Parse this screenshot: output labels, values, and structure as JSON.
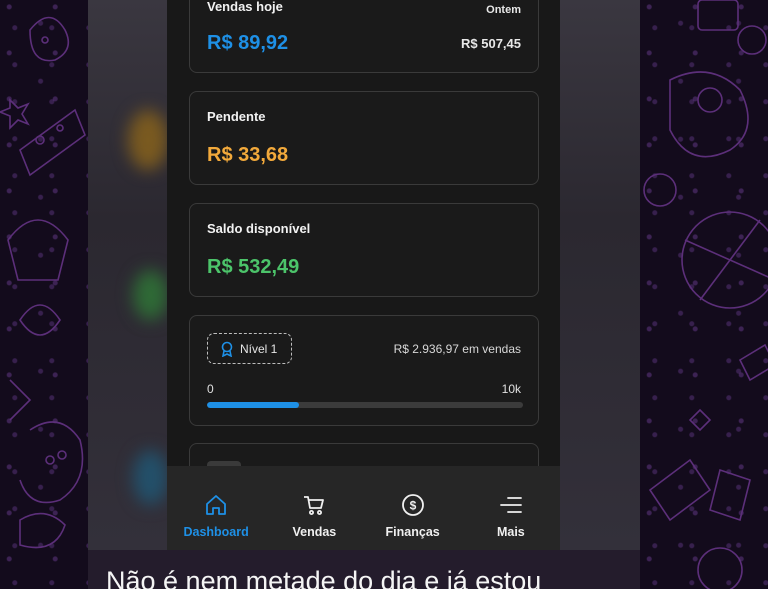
{
  "cards": {
    "vendas_hoje": {
      "title": "Vendas hoje",
      "value": "R$ 89,92",
      "compare_label": "Ontem",
      "compare_value": "R$ 507,45"
    },
    "pendente": {
      "title": "Pendente",
      "value": "R$ 33,68"
    },
    "saldo": {
      "title": "Saldo disponível",
      "value": "R$ 532,49"
    },
    "nivel": {
      "badge": "Nível 1",
      "sales_text": "R$ 2.936,97 em vendas",
      "min_label": "0",
      "max_label": "10k",
      "progress": 0.29
    }
  },
  "nav": {
    "items": [
      {
        "label": "Dashboard",
        "icon": "home-icon",
        "active": true
      },
      {
        "label": "Vendas",
        "icon": "cart-icon",
        "active": false
      },
      {
        "label": "Finanças",
        "icon": "dollar-coin-icon",
        "active": false
      },
      {
        "label": "Mais",
        "icon": "menu-icon",
        "active": false
      }
    ]
  },
  "caption": "Não é  nem  metade do dia e já estou",
  "colors": {
    "blue": "#1e90e6",
    "orange": "#f2a93b",
    "green": "#4cc46a"
  }
}
